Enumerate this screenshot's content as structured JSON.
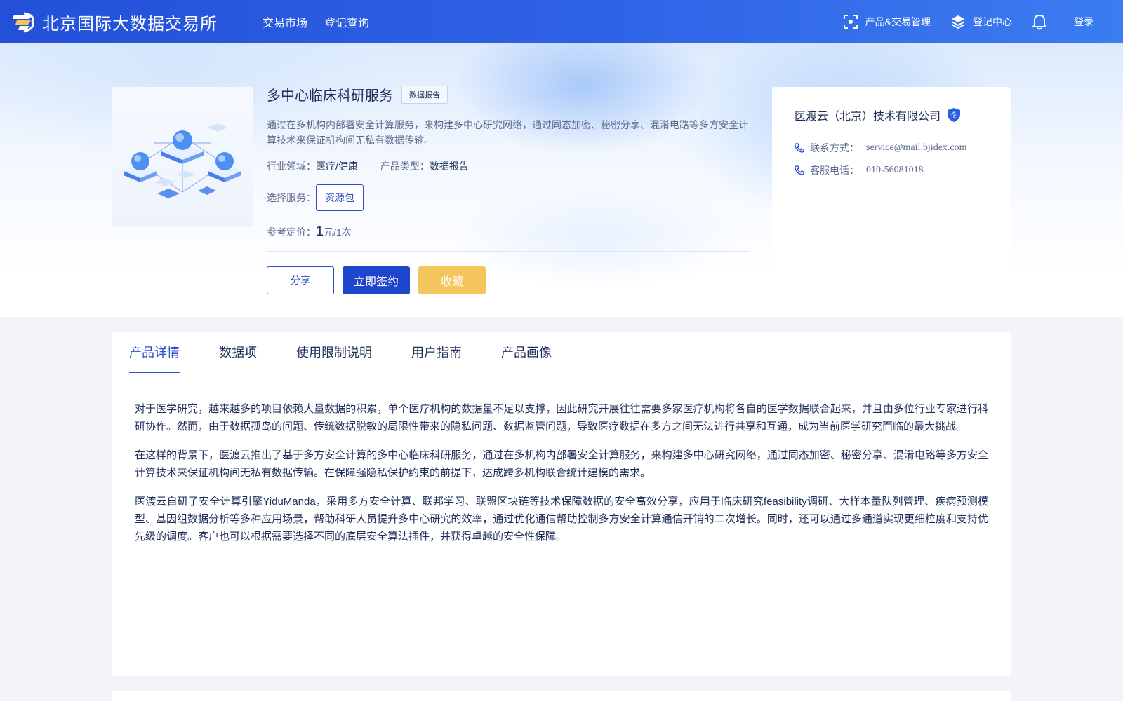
{
  "header": {
    "site_title": "北京国际大数据交易所",
    "nav": [
      "交易市场",
      "登记查询"
    ],
    "product_mgmt": "产品&交易管理",
    "registry_center": "登记中心",
    "login": "登录"
  },
  "product": {
    "title": "多中心临床科研服务",
    "tag": "数据报告",
    "description": "通过在多机构内部署安全计算服务，来构建多中心研究网络，通过同态加密、秘密分享、混淆电路等多方安全计算技术来保证机构间无私有数据传输。",
    "industry_label": "行业领域：",
    "industry_value": "医疗/健康",
    "type_label": "产品类型：",
    "type_value": "数据报告",
    "service_label": "选择服务：",
    "service_option": "资源包",
    "price_label": "参考定价：",
    "price_value": "1",
    "price_unit": "元/1次",
    "buttons": {
      "share": "分享",
      "sign": "立即签约",
      "favorite": "收藏"
    }
  },
  "company": {
    "name": "医渡云（北京）技术有限公司",
    "badge": "企",
    "contact_label": "联系方式：",
    "contact_value": "service@mail.bjidex.com",
    "phone_label": "客服电话：",
    "phone_value": "010-56081018"
  },
  "tabs": [
    "产品详情",
    "数据项",
    "使用限制说明",
    "用户指南",
    "产品画像"
  ],
  "active_tab": 0,
  "detail": {
    "paragraphs": [
      "对于医学研究，越来越多的项目依赖大量数据的积累，单个医疗机构的数据量不足以支撑，因此研究开展往往需要多家医疗机构将各自的医学数据联合起来，并且由多位行业专家进行科研协作。然而，由于数据孤岛的问题、传统数据脱敏的局限性带来的隐私问题、数据监管问题，导致医疗数据在多方之间无法进行共享和互通，成为当前医学研究面临的最大挑战。",
      "在这样的背景下，医渡云推出了基于多方安全计算的多中心临床科研服务，通过在多机构内部署安全计算服务，来构建多中心研究网络，通过同态加密、秘密分享、混淆电路等多方安全计算技术来保证机构间无私有数据传输。在保障强隐私保护约束的前提下，达成跨多机构联合统计建模的需求。",
      "医渡云自研了安全计算引擎YiduMandа，采用多方安全计算、联邦学习、联盟区块链等技术保障数据的安全高效分享，应用于临床研究feasibility调研、大样本量队列管理、疾病预测模型、基因组数据分析等多种应用场景，帮助科研人员提升多中心研究的效率，通过优化通信帮助控制多方安全计算通信开销的二次增长。同时，还可以通过多通道实现更细粒度和支持优先级的调度。客户也可以根据需要选择不同的底层安全算法插件，并获得卓越的安全性保障。"
    ]
  },
  "colors": {
    "primary": "#2a4fc9",
    "header_start": "#2350d8",
    "header_end": "#3b7cf0",
    "favorite": "#f5c55d"
  }
}
